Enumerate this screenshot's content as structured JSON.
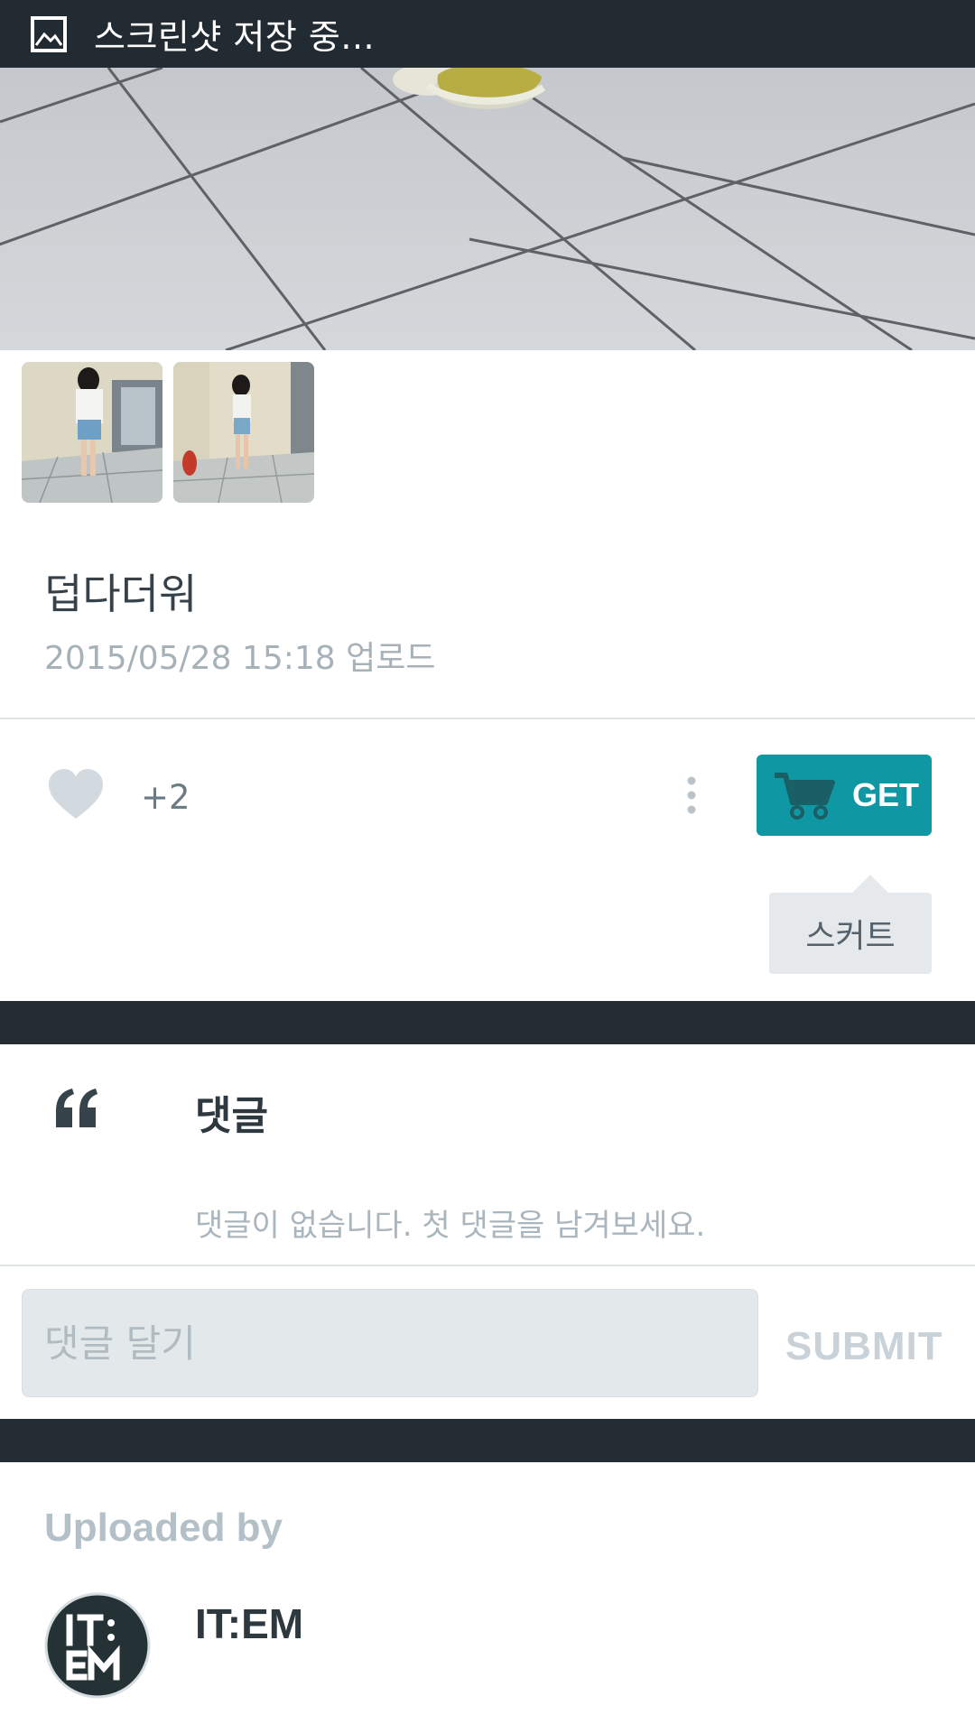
{
  "status_bar": {
    "text": "스크린샷 저장 중...",
    "icon": "image-icon"
  },
  "post": {
    "title": "덥다더워",
    "date": "2015/05/28 15:18 업로드",
    "hero_image": "photo-of-sneakers-on-tile-floor",
    "thumbnails": [
      "thumbnail-photo-1",
      "thumbnail-photo-2"
    ]
  },
  "actions": {
    "heart_icon": "heart-icon",
    "likes": "+2",
    "more_icon": "more-vertical-icon",
    "get_label": "GET",
    "cart_icon": "cart-icon",
    "tag_label": "스커트"
  },
  "comments": {
    "icon": "quote-icon",
    "title": "댓글",
    "empty_message": "댓글이 없습니다. 첫 댓글을 남겨보세요.",
    "input_placeholder": "댓글 달기",
    "input_value": "",
    "submit_label": "SUBMIT"
  },
  "uploader": {
    "label": "Uploaded by",
    "name": "IT:EM",
    "avatar_text": "IT:EM"
  },
  "colors": {
    "status_bar": "#212b31",
    "accent": "#0f97a4",
    "dark_band": "#232d33",
    "muted_text": "#a6b1b8"
  }
}
